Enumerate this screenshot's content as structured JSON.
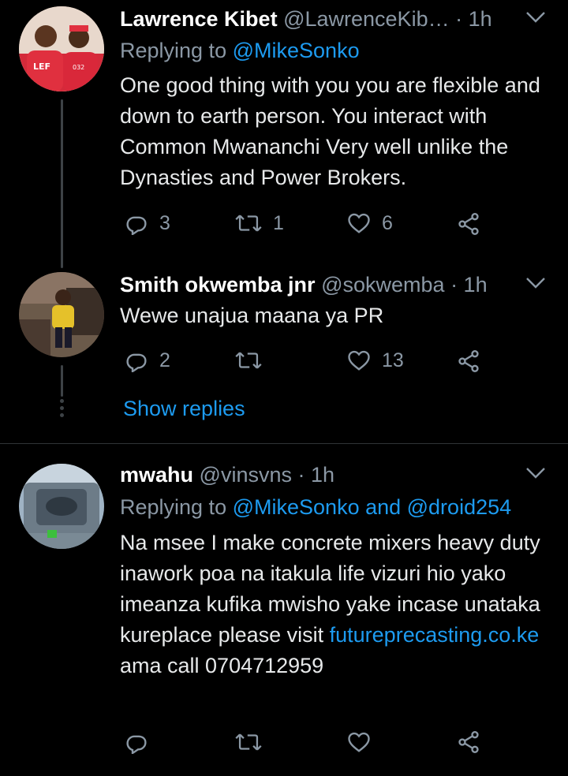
{
  "colors": {
    "background": "#000000",
    "link": "#1d9bf0",
    "muted": "#8b98a5",
    "text": "#e7e9ea"
  },
  "tweets": [
    {
      "name": "Lawrence Kibet",
      "handle": "@LawrenceKib…",
      "time": "· 1h",
      "replying_prefix": "Replying to",
      "replying_to": "@MikeSonko",
      "text": "One good  thing with you you are flexible and down to earth person. You interact with Common Mwananchi Very well unlike the Dynasties and Power Brokers.",
      "replies": "3",
      "retweets": "1",
      "likes": "6"
    },
    {
      "name": "Smith okwemba jnr",
      "handle": "@sokwemba",
      "time": "· 1h",
      "text": "Wewe unajua maana ya PR",
      "replies": "2",
      "retweets": "",
      "likes": "13",
      "show_replies": "Show replies"
    },
    {
      "name": "mwahu",
      "handle": "@vinsvns",
      "time": "· 1h",
      "replying_prefix": "Replying to",
      "replying_to": "@MikeSonko and @droid254",
      "text_before_link": "Na msee I make concrete mixers heavy duty inawork poa na itakula life vizuri hio yako imeanza kufika mwisho yake incase unataka kureplace please visit ",
      "link": "futureprecasting.co.ke",
      "text_after_link": " ama call 0704712959",
      "replies": "",
      "retweets": "",
      "likes": ""
    }
  ],
  "icons": {
    "reply": "reply-icon",
    "retweet": "retweet-icon",
    "like": "heart-icon",
    "share": "share-icon",
    "more": "chevron-down-icon"
  }
}
